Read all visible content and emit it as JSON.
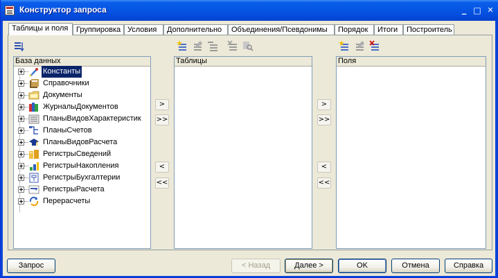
{
  "window": {
    "title": "Конструктор запроса",
    "minimize": "_",
    "maximize": "□",
    "close": "✕"
  },
  "tabs": [
    {
      "label": "Таблицы и поля",
      "active": true
    },
    {
      "label": "Группировка"
    },
    {
      "label": "Условия"
    },
    {
      "label": "Дополнительно"
    },
    {
      "label": "Объединения/Псевдонимы"
    },
    {
      "label": "Порядок"
    },
    {
      "label": "Итоги"
    },
    {
      "label": "Построитель"
    }
  ],
  "database": {
    "header": "База данных",
    "items": [
      {
        "label": "Константы",
        "icon": "constants-icon",
        "selected": true
      },
      {
        "label": "Справочники",
        "icon": "catalogs-icon"
      },
      {
        "label": "Документы",
        "icon": "documents-icon"
      },
      {
        "label": "ЖурналыДокументов",
        "icon": "document-journals-icon"
      },
      {
        "label": "ПланыВидовХарактеристик",
        "icon": "characteristic-types-icon"
      },
      {
        "label": "ПланыСчетов",
        "icon": "charts-of-accounts-icon"
      },
      {
        "label": "ПланыВидовРасчета",
        "icon": "calculation-types-icon"
      },
      {
        "label": "РегистрыСведений",
        "icon": "information-registers-icon"
      },
      {
        "label": "РегистрыНакопления",
        "icon": "accumulation-registers-icon"
      },
      {
        "label": "РегистрыБухгалтерии",
        "icon": "accounting-registers-icon"
      },
      {
        "label": "РегистрыРасчета",
        "icon": "calculation-registers-icon"
      },
      {
        "label": "Перерасчеты",
        "icon": "recalculations-icon"
      }
    ]
  },
  "tables": {
    "header": "Таблицы"
  },
  "fields": {
    "header": "Поля"
  },
  "transfer": {
    "move_one": ">",
    "move_all": ">>",
    "remove_one": "<",
    "remove_all": "<<"
  },
  "footer": {
    "query": "Запрос",
    "back": "< Назад",
    "next": "Далее >",
    "ok": "OK",
    "cancel": "Отмена",
    "help": "Справка"
  }
}
